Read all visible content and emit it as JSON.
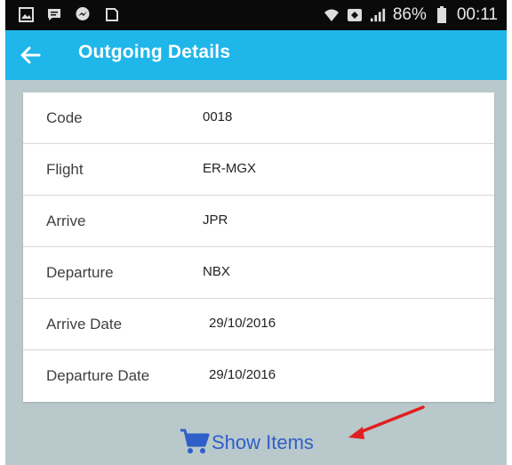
{
  "statusbar": {
    "battery": "86%",
    "time": "00:11",
    "left_icons": [
      "gallery-icon",
      "chat-icon",
      "messenger-icon",
      "notification-icon"
    ],
    "right_icons": [
      "wifi-icon",
      "data-saver-icon",
      "signal-icon",
      "battery-icon"
    ]
  },
  "appbar": {
    "title": "Outgoing Details",
    "back_icon": "back-arrow-icon"
  },
  "details": [
    {
      "label": "Code",
      "value": "0018"
    },
    {
      "label": "Flight",
      "value": "ER-MGX"
    },
    {
      "label": "Arrive",
      "value": "JPR"
    },
    {
      "label": "Departure",
      "value": "NBX"
    },
    {
      "label": "Arrive Date",
      "value": "29/10/2016"
    },
    {
      "label": "Departure Date",
      "value": "29/10/2016"
    }
  ],
  "show_items": {
    "label": "Show Items",
    "icon": "cart-icon"
  },
  "colors": {
    "appbar": "#1fb6ea",
    "background": "#b9c8ca",
    "link": "#2f5fc8",
    "annotation_arrow": "#e02020"
  }
}
